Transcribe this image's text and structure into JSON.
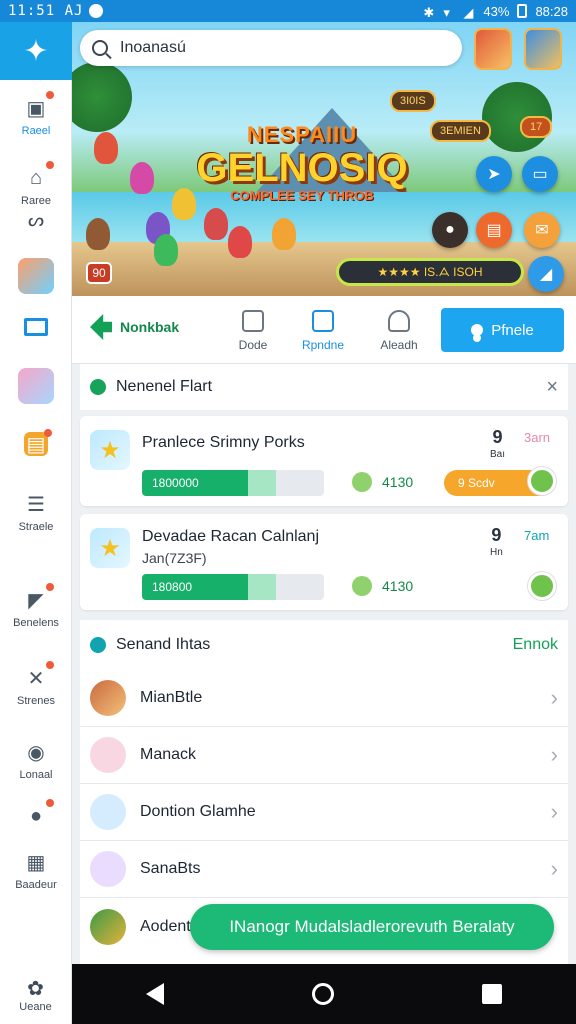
{
  "status": {
    "time": "11:51 AJ",
    "battery": "43%",
    "clock_right": "88:28"
  },
  "sidebar": {
    "items": [
      {
        "label": "Raeel",
        "icon": "image-icon"
      },
      {
        "label": "Raree",
        "icon": "home-icon"
      },
      {
        "label": "ᔕ",
        "icon": "loop-icon"
      },
      {
        "label": "",
        "icon": "avatar-game-icon"
      },
      {
        "label": "",
        "icon": "tablet-icon"
      },
      {
        "label": "",
        "icon": "avatar-girl-icon"
      },
      {
        "label": "",
        "icon": "gift-icon"
      },
      {
        "label": "Straele",
        "icon": "document-icon"
      },
      {
        "label": "Benelens",
        "icon": "megaphone-icon"
      },
      {
        "label": "Strenes",
        "icon": "controller-icon"
      },
      {
        "label": "Lonaal",
        "icon": "chat-icon"
      },
      {
        "label": "",
        "icon": "person-icon"
      },
      {
        "label": "Baadeur",
        "icon": "grid-icon"
      }
    ],
    "bottom_label": "Ueane"
  },
  "search": {
    "placeholder": "Inoanasú"
  },
  "banner": {
    "logo_line1": "NESPAIIU",
    "logo_line2": "GELNOSIQ",
    "logo_line3": "COMPLEE SEY THROB",
    "tag1": "3I0IS",
    "tag2": "3EMIEN",
    "badge": "90",
    "rating": "★★★★ IS.ᗋ ISOH",
    "corner_tag": "17"
  },
  "tabs": {
    "logo": "Nonkbak",
    "items": [
      {
        "label": "Dode",
        "active": false
      },
      {
        "label": "Rpndne",
        "active": true
      },
      {
        "label": "Aleadh",
        "active": false
      }
    ],
    "profile_button": "Pfnele"
  },
  "section1": {
    "title": "Nenenel Flart",
    "close": "×"
  },
  "cards": [
    {
      "title": "Pranlece Srimny Porks",
      "sub": "",
      "progress_text": "1800000",
      "progress": 0.63,
      "score": "4130",
      "rank": "9",
      "rank_sub": "Baı",
      "time": "3arn",
      "pill": "9 Scdv"
    },
    {
      "title": "Devadae Racan Calnlanj",
      "sub": "Jan(7Z3F)",
      "progress_text": "180800",
      "progress": 0.63,
      "score": "4130",
      "rank": "9",
      "rank_sub": "Hn",
      "time": "7am",
      "pill": ""
    }
  ],
  "section2": {
    "title": "Senand Ihtas",
    "link": "Ennok"
  },
  "list": [
    {
      "label": "MianBtle"
    },
    {
      "label": "Manack"
    },
    {
      "label": "Dontion Glamhe"
    },
    {
      "label": "SanaBts"
    },
    {
      "label": "Aodent"
    }
  ],
  "toast": {
    "text": "INanogr Mudalsladlerorevuth Beralaty"
  },
  "colors": {
    "accent": "#1a8ee0",
    "green": "#17b06a",
    "orange": "#f6a72b"
  }
}
